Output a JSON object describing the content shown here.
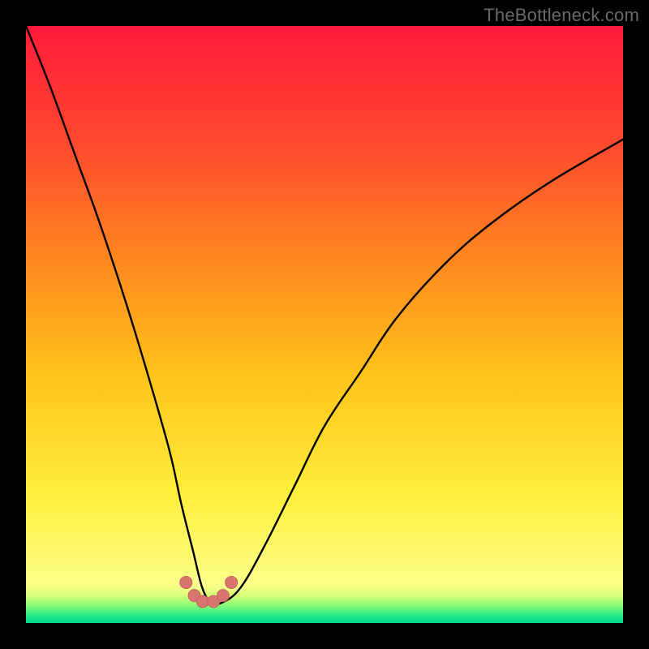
{
  "watermark": "TheBottleneck.com",
  "colors": {
    "black": "#000000",
    "curve": "#000000",
    "marker_fill": "#d97570",
    "marker_stroke": "#c7605b",
    "gradient_stops": [
      {
        "offset": 0.0,
        "color": "#ff1a3a"
      },
      {
        "offset": 0.2,
        "color": "#ff4a2e"
      },
      {
        "offset": 0.4,
        "color": "#ff8a1e"
      },
      {
        "offset": 0.58,
        "color": "#ffc21a"
      },
      {
        "offset": 0.78,
        "color": "#ffee3a"
      },
      {
        "offset": 0.935,
        "color": "#fdff8a"
      },
      {
        "offset": 0.954,
        "color": "#d7ff7a"
      },
      {
        "offset": 0.966,
        "color": "#a0ff76"
      },
      {
        "offset": 0.978,
        "color": "#5cf57e"
      },
      {
        "offset": 0.988,
        "color": "#24e889"
      },
      {
        "offset": 1.0,
        "color": "#00db8f"
      }
    ]
  },
  "chart_data": {
    "type": "line",
    "title": "",
    "xlabel": "",
    "ylabel": "",
    "xlim": [
      0,
      100
    ],
    "ylim": [
      0,
      100
    ],
    "grid": false,
    "legend": false,
    "series": [
      {
        "name": "bottleneck-curve",
        "x": [
          0,
          4,
          8,
          12,
          16,
          20,
          24,
          26,
          28,
          29.5,
          31,
          33,
          36,
          40,
          45,
          50,
          56,
          62,
          70,
          78,
          88,
          100
        ],
        "y": [
          100,
          90,
          79,
          68,
          56,
          43,
          29,
          20,
          12,
          6,
          3.5,
          3.5,
          6,
          13,
          23,
          33,
          42,
          51,
          60,
          67,
          74,
          81
        ]
      }
    ],
    "markers": {
      "name": "valley-markers",
      "x": [
        26.8,
        28.2,
        29.6,
        31.4,
        33.0,
        34.4
      ],
      "y": [
        6.8,
        4.6,
        3.6,
        3.6,
        4.6,
        6.8
      ]
    },
    "notes": "y-axis is inverted visually (0 at bottom, 100 at top). Background is a vertical rainbow gradient red→yellow→green. Curve is a V/U shape with minimum near x≈30."
  }
}
